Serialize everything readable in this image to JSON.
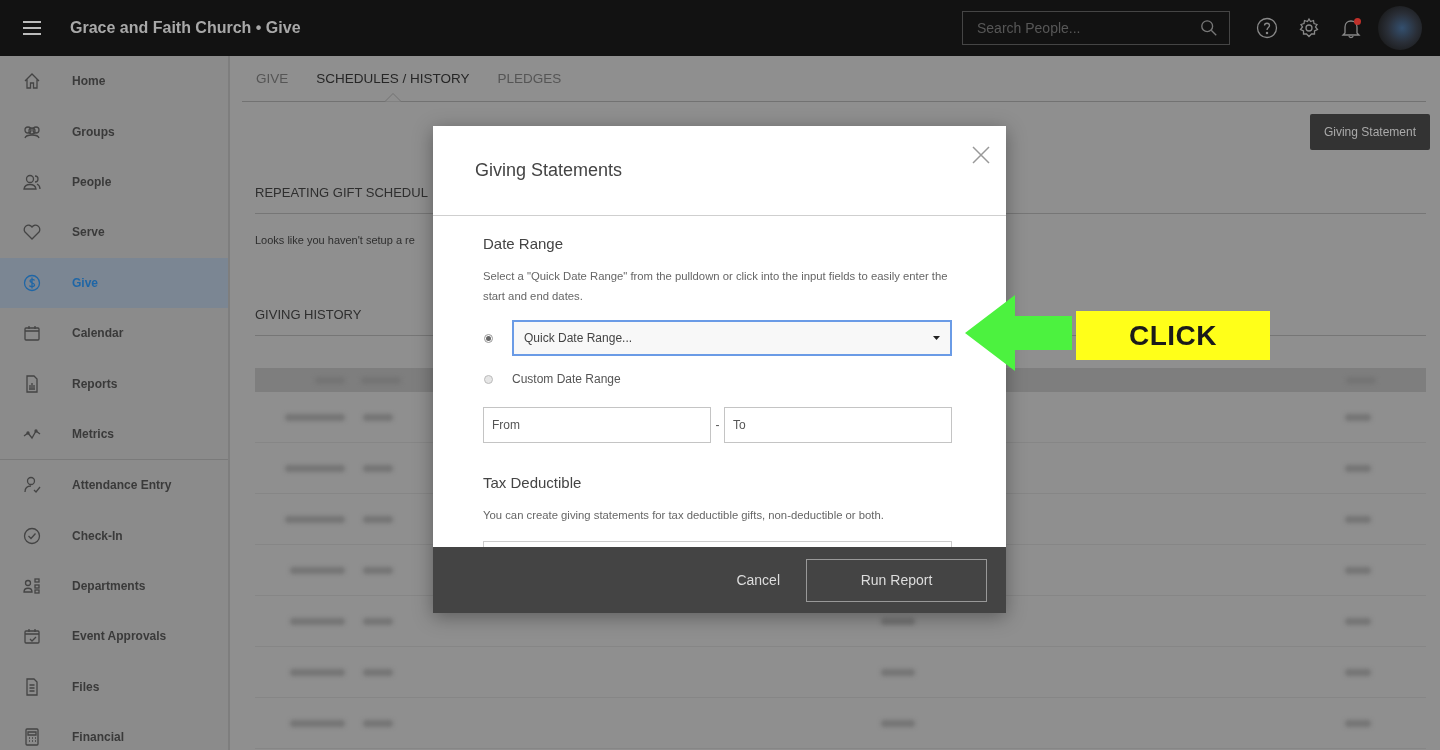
{
  "app_bar": {
    "title": "Grace and Faith Church • Give",
    "search": {
      "placeholder": "Search People..."
    },
    "has_notifications": true
  },
  "sidebar": {
    "sections": [
      {
        "items": [
          {
            "label": "Home",
            "selected": false
          },
          {
            "label": "Groups",
            "selected": false
          },
          {
            "label": "People",
            "selected": false
          },
          {
            "label": "Serve",
            "selected": false
          },
          {
            "label": "Give",
            "selected": true
          },
          {
            "label": "Calendar",
            "selected": false
          },
          {
            "label": "Reports",
            "selected": false
          },
          {
            "label": "Metrics",
            "selected": false
          }
        ]
      },
      {
        "items": [
          {
            "label": "Attendance Entry",
            "selected": false
          },
          {
            "label": "Check-In",
            "selected": false
          },
          {
            "label": "Departments",
            "selected": false
          },
          {
            "label": "Event Approvals",
            "selected": false
          },
          {
            "label": "Files",
            "selected": false
          },
          {
            "label": "Financial",
            "selected": false
          }
        ]
      }
    ]
  },
  "tabs": [
    {
      "label": "GIVE",
      "selected": false
    },
    {
      "label": "SCHEDULES / HISTORY",
      "selected": true
    },
    {
      "label": "PLEDGES",
      "selected": false
    }
  ],
  "toolbar": {
    "button": "Giving Statement"
  },
  "repeating": {
    "title": "REPEATING GIFT SCHEDUL",
    "message": "Looks like you haven't setup a re"
  },
  "history": {
    "title": "GIVING HISTORY"
  },
  "modal": {
    "title": "Giving Statements",
    "date_range": {
      "heading": "Date Range",
      "description": "Select a \"Quick Date Range\" from the pulldown or click into the input fields to easily enter the start and end dates.",
      "options": [
        {
          "kind": "select",
          "label": "Quick Date Range...",
          "selected": true,
          "focused": true
        },
        {
          "kind": "custom",
          "label": "Custom Date Range",
          "selected": false
        }
      ],
      "from": {
        "placeholder": "From"
      },
      "separator": "-",
      "to": {
        "placeholder": "To"
      }
    },
    "tax": {
      "heading": "Tax Deductible",
      "description": "You can create giving statements for tax deductible gifts, non-deductible or both."
    },
    "cancel": "Cancel",
    "submit": "Run Report"
  },
  "callout": {
    "label": "CLICK"
  }
}
